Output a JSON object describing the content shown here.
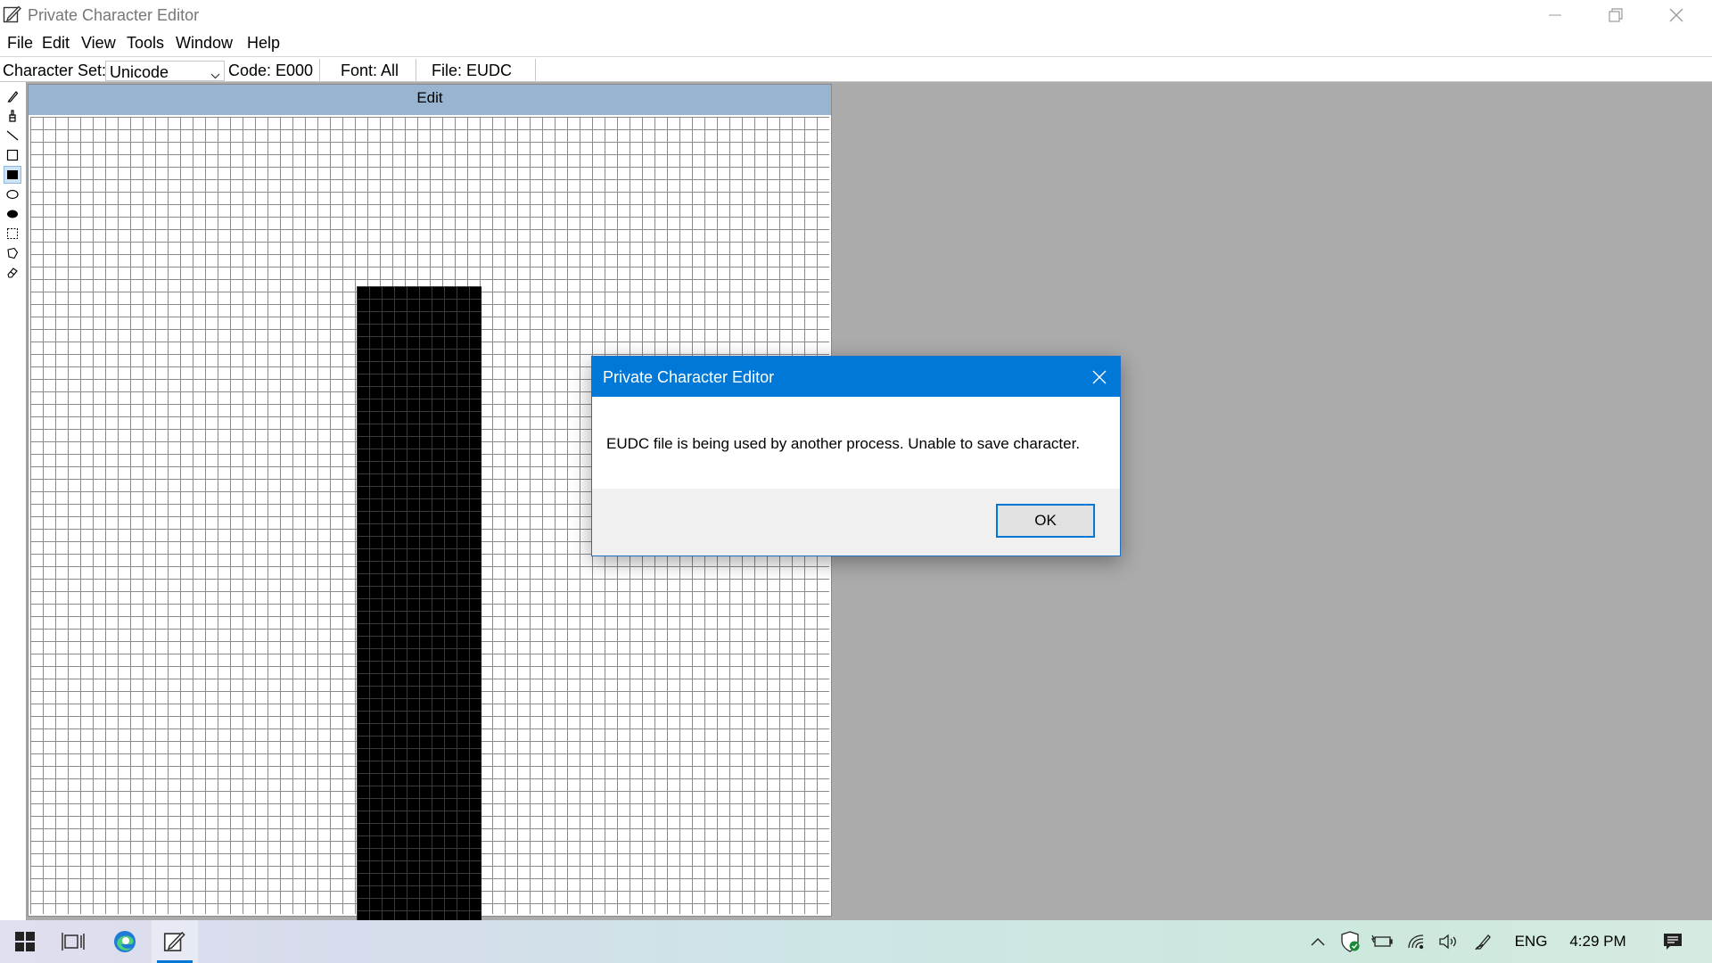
{
  "window": {
    "title": "Private Character Editor"
  },
  "menu": {
    "items": [
      {
        "label": "File"
      },
      {
        "label": "Edit"
      },
      {
        "label": "View"
      },
      {
        "label": "Tools"
      },
      {
        "label": "Window"
      },
      {
        "label": "Help"
      }
    ]
  },
  "info": {
    "charset_label": "Character Set:",
    "charset_value": "Unicode",
    "code": "Code: E000",
    "font": "Font: All",
    "file": "File: EUDC"
  },
  "toolbox": {
    "tools": [
      "pencil-icon",
      "brush-icon",
      "line-icon",
      "hollow-rectangle-icon",
      "filled-rectangle-icon",
      "hollow-ellipse-icon",
      "filled-ellipse-icon",
      "rectangular-selection-icon",
      "freeform-selection-icon",
      "eraser-icon"
    ],
    "active_tool": "filled-rectangle-icon"
  },
  "edit_window": {
    "caption": "Edit"
  },
  "dialog": {
    "title": "Private Character Editor",
    "message": "EUDC file is being used by another process. Unable to save character.",
    "ok_label": "OK"
  },
  "taskbar": {
    "language": "ENG",
    "time": "4:29 PM"
  },
  "colors": {
    "dialog_title_bg": "#0078d7",
    "edit_caption_bg": "#99b4d1",
    "workspace_bg": "#ababab"
  }
}
